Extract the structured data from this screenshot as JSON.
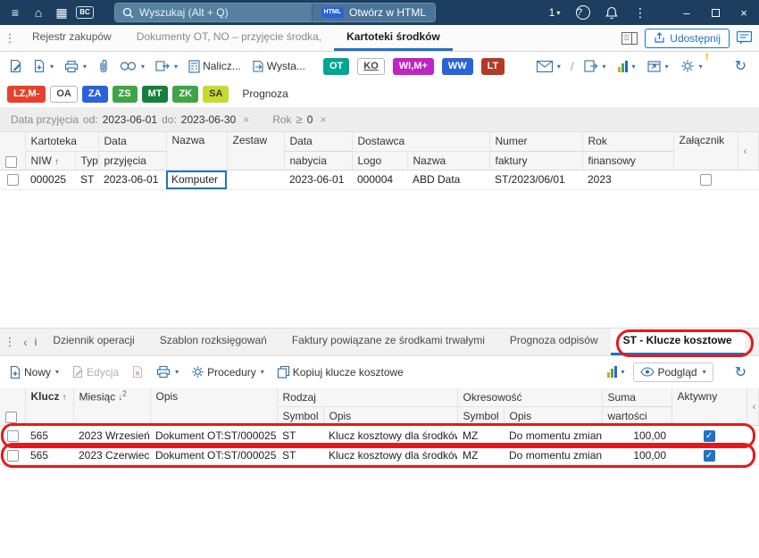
{
  "colors": {
    "topbar_bg": "#1d3e5e",
    "accent_blue": "#1f72c4",
    "annotation_red": "#e01b1b"
  },
  "topbar": {
    "bc_badge": "BC",
    "search_placeholder": "Wyszukaj (Alt + Q)",
    "html_badge": "HTML",
    "open_html_label": "Otwórz w HTML",
    "counter": "1"
  },
  "doc_tabs": {
    "tab1": "Rejestr zakupów",
    "tab2": "Dokumenty OT, NO – przyjęcie środka,",
    "tab3": "Kartoteki środków",
    "share_label": "Udostępnij"
  },
  "toolbar": {
    "nalicz_label": "Nalicz...",
    "wystaw_label": "Wysta...",
    "badges": [
      {
        "label": "OT",
        "bg": "#00a693",
        "fg": "#ffffff"
      },
      {
        "label": "KO",
        "bg": "#ffffff",
        "fg": "#444444"
      },
      {
        "label": "WI,M+",
        "bg": "#bf25c0",
        "fg": "#ffffff"
      },
      {
        "label": "WW",
        "bg": "#2b62d9",
        "fg": "#ffffff"
      },
      {
        "label": "LT",
        "bg": "#b23b25",
        "fg": "#ffffff"
      }
    ]
  },
  "quick_filters": {
    "badges": [
      {
        "label": "LZ,M-",
        "bg": "#e8402b",
        "fg": "#ffffff"
      },
      {
        "label": "OA",
        "bg": "#ffffff",
        "fg": "#444444"
      },
      {
        "label": "ZA",
        "bg": "#2b62d9",
        "fg": "#ffffff"
      },
      {
        "label": "ZS",
        "bg": "#41a347",
        "fg": "#ffffff"
      },
      {
        "label": "MT",
        "bg": "#157f3c",
        "fg": "#ffffff"
      },
      {
        "label": "ZK",
        "bg": "#41a347",
        "fg": "#ffffff"
      },
      {
        "label": "SA",
        "bg": "#c8da30",
        "fg": "#3a3a3a"
      }
    ],
    "prognoza_label": "Prognoza"
  },
  "filter_bar": {
    "chip1_label": "Data przyjęcia",
    "chip1_od": "od:",
    "chip1_od_value": "2023-06-01",
    "chip1_do": "do:",
    "chip1_do_value": "2023-06-30",
    "chip2_label": "Rok",
    "chip2_operator": "≥",
    "chip2_value": "0",
    "remove_glyph": "×"
  },
  "upper_grid": {
    "headers": {
      "kartoteka_group": "Kartoteka",
      "niw": "NIW",
      "niw_sort": "↑",
      "typ": "Typ",
      "data_przyjecia_top": "Data",
      "data_przyjecia_bottom": "przyjęcia",
      "nazwa": "Nazwa",
      "zestaw": "Zestaw",
      "data_nabycia_top": "Data",
      "data_nabycia_bottom": "nabycia",
      "dostawca_group": "Dostawca",
      "logo": "Logo",
      "dostawca_nazwa": "Nazwa",
      "numer_top": "Numer",
      "numer_bottom": "faktury",
      "rok_top": "Rok",
      "rok_bottom": "finansowy",
      "zalacznik": "Załącznik"
    },
    "rows": [
      {
        "niw": "000025",
        "typ": "ST",
        "data_przyjecia": "2023-06-01",
        "nazwa": "Komputer",
        "zestaw": "",
        "data_nabycia": "2023-06-01",
        "logo": "000004",
        "dostawca_nazwa": "ABD Data",
        "numer_faktury": "ST/2023/06/01",
        "rok_finansowy": "2023",
        "zalacznik_checked": false
      }
    ]
  },
  "lower_tabs": {
    "partial": "i",
    "tab1": "Dziennik operacji",
    "tab2": "Szablon rozksięgowań",
    "tab3": "Faktury powiązane ze środkami trwałymi",
    "tab4": "Prognoza odpisów",
    "tab5": "ST - Klucze kosztowe"
  },
  "lower_toolbar": {
    "nowy": "Nowy",
    "edycja": "Edycja",
    "procedury": "Procedury",
    "kopiuj": "Kopiuj klucze kosztowe",
    "podglad": "Podgląd"
  },
  "lower_grid": {
    "headers": {
      "klucz": "Klucz",
      "klucz_sort": "↑",
      "miesiac": "Miesiąc",
      "miesiac_sort": "↓",
      "miesiac_sort_order": "2",
      "opis": "Opis",
      "rodzaj_group": "Rodzaj",
      "rodzaj_symbol": "Symbol",
      "rodzaj_opis": "Opis",
      "okresowosc_group": "Okresowość",
      "okres_symbol": "Symbol",
      "okres_opis": "Opis",
      "suma_top": "Suma",
      "suma_bottom": "wartości",
      "aktywny": "Aktywny"
    },
    "rows": [
      {
        "klucz": "565",
        "miesiac": "2023 Wrzesień",
        "opis": "Dokument OT:ST/000025",
        "rodzaj_symbol": "ST",
        "rodzaj_opis": "Klucz kosztowy dla środków",
        "okres_symbol": "MZ",
        "okres_opis": "Do momentu zmiany",
        "suma": "100,00",
        "aktywny": true
      },
      {
        "klucz": "565",
        "miesiac": "2023 Czerwiec",
        "opis": "Dokument OT:ST/000025",
        "rodzaj_symbol": "ST",
        "rodzaj_opis": "Klucz kosztowy dla środków",
        "okres_symbol": "MZ",
        "okres_opis": "Do momentu zmiany",
        "suma": "100,00",
        "aktywny": true
      }
    ]
  }
}
